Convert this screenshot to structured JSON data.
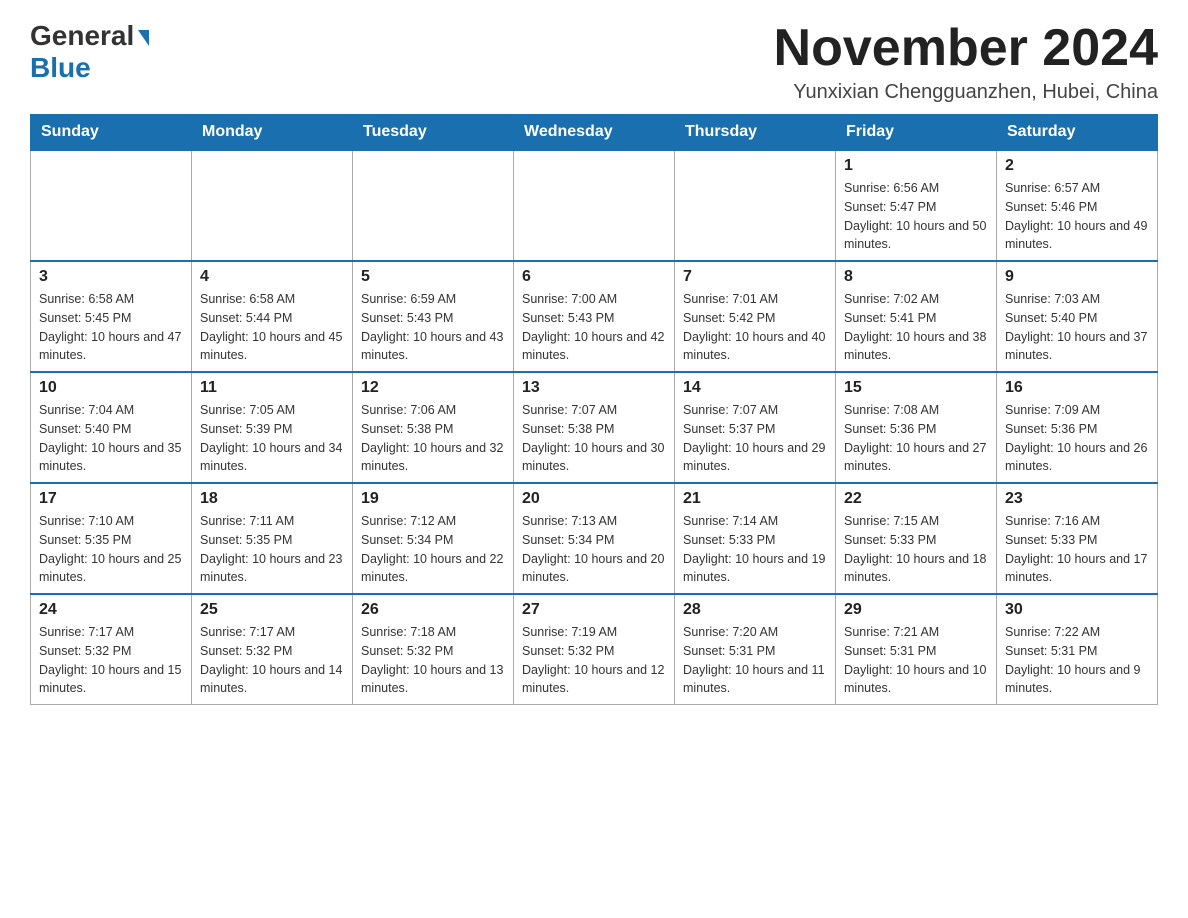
{
  "header": {
    "logo_general": "General",
    "logo_blue": "Blue",
    "month_title": "November 2024",
    "location": "Yunxixian Chengguanzhen, Hubei, China"
  },
  "weekdays": [
    "Sunday",
    "Monday",
    "Tuesday",
    "Wednesday",
    "Thursday",
    "Friday",
    "Saturday"
  ],
  "weeks": [
    [
      {
        "day": "",
        "info": ""
      },
      {
        "day": "",
        "info": ""
      },
      {
        "day": "",
        "info": ""
      },
      {
        "day": "",
        "info": ""
      },
      {
        "day": "",
        "info": ""
      },
      {
        "day": "1",
        "info": "Sunrise: 6:56 AM\nSunset: 5:47 PM\nDaylight: 10 hours and 50 minutes."
      },
      {
        "day": "2",
        "info": "Sunrise: 6:57 AM\nSunset: 5:46 PM\nDaylight: 10 hours and 49 minutes."
      }
    ],
    [
      {
        "day": "3",
        "info": "Sunrise: 6:58 AM\nSunset: 5:45 PM\nDaylight: 10 hours and 47 minutes."
      },
      {
        "day": "4",
        "info": "Sunrise: 6:58 AM\nSunset: 5:44 PM\nDaylight: 10 hours and 45 minutes."
      },
      {
        "day": "5",
        "info": "Sunrise: 6:59 AM\nSunset: 5:43 PM\nDaylight: 10 hours and 43 minutes."
      },
      {
        "day": "6",
        "info": "Sunrise: 7:00 AM\nSunset: 5:43 PM\nDaylight: 10 hours and 42 minutes."
      },
      {
        "day": "7",
        "info": "Sunrise: 7:01 AM\nSunset: 5:42 PM\nDaylight: 10 hours and 40 minutes."
      },
      {
        "day": "8",
        "info": "Sunrise: 7:02 AM\nSunset: 5:41 PM\nDaylight: 10 hours and 38 minutes."
      },
      {
        "day": "9",
        "info": "Sunrise: 7:03 AM\nSunset: 5:40 PM\nDaylight: 10 hours and 37 minutes."
      }
    ],
    [
      {
        "day": "10",
        "info": "Sunrise: 7:04 AM\nSunset: 5:40 PM\nDaylight: 10 hours and 35 minutes."
      },
      {
        "day": "11",
        "info": "Sunrise: 7:05 AM\nSunset: 5:39 PM\nDaylight: 10 hours and 34 minutes."
      },
      {
        "day": "12",
        "info": "Sunrise: 7:06 AM\nSunset: 5:38 PM\nDaylight: 10 hours and 32 minutes."
      },
      {
        "day": "13",
        "info": "Sunrise: 7:07 AM\nSunset: 5:38 PM\nDaylight: 10 hours and 30 minutes."
      },
      {
        "day": "14",
        "info": "Sunrise: 7:07 AM\nSunset: 5:37 PM\nDaylight: 10 hours and 29 minutes."
      },
      {
        "day": "15",
        "info": "Sunrise: 7:08 AM\nSunset: 5:36 PM\nDaylight: 10 hours and 27 minutes."
      },
      {
        "day": "16",
        "info": "Sunrise: 7:09 AM\nSunset: 5:36 PM\nDaylight: 10 hours and 26 minutes."
      }
    ],
    [
      {
        "day": "17",
        "info": "Sunrise: 7:10 AM\nSunset: 5:35 PM\nDaylight: 10 hours and 25 minutes."
      },
      {
        "day": "18",
        "info": "Sunrise: 7:11 AM\nSunset: 5:35 PM\nDaylight: 10 hours and 23 minutes."
      },
      {
        "day": "19",
        "info": "Sunrise: 7:12 AM\nSunset: 5:34 PM\nDaylight: 10 hours and 22 minutes."
      },
      {
        "day": "20",
        "info": "Sunrise: 7:13 AM\nSunset: 5:34 PM\nDaylight: 10 hours and 20 minutes."
      },
      {
        "day": "21",
        "info": "Sunrise: 7:14 AM\nSunset: 5:33 PM\nDaylight: 10 hours and 19 minutes."
      },
      {
        "day": "22",
        "info": "Sunrise: 7:15 AM\nSunset: 5:33 PM\nDaylight: 10 hours and 18 minutes."
      },
      {
        "day": "23",
        "info": "Sunrise: 7:16 AM\nSunset: 5:33 PM\nDaylight: 10 hours and 17 minutes."
      }
    ],
    [
      {
        "day": "24",
        "info": "Sunrise: 7:17 AM\nSunset: 5:32 PM\nDaylight: 10 hours and 15 minutes."
      },
      {
        "day": "25",
        "info": "Sunrise: 7:17 AM\nSunset: 5:32 PM\nDaylight: 10 hours and 14 minutes."
      },
      {
        "day": "26",
        "info": "Sunrise: 7:18 AM\nSunset: 5:32 PM\nDaylight: 10 hours and 13 minutes."
      },
      {
        "day": "27",
        "info": "Sunrise: 7:19 AM\nSunset: 5:32 PM\nDaylight: 10 hours and 12 minutes."
      },
      {
        "day": "28",
        "info": "Sunrise: 7:20 AM\nSunset: 5:31 PM\nDaylight: 10 hours and 11 minutes."
      },
      {
        "day": "29",
        "info": "Sunrise: 7:21 AM\nSunset: 5:31 PM\nDaylight: 10 hours and 10 minutes."
      },
      {
        "day": "30",
        "info": "Sunrise: 7:22 AM\nSunset: 5:31 PM\nDaylight: 10 hours and 9 minutes."
      }
    ]
  ]
}
